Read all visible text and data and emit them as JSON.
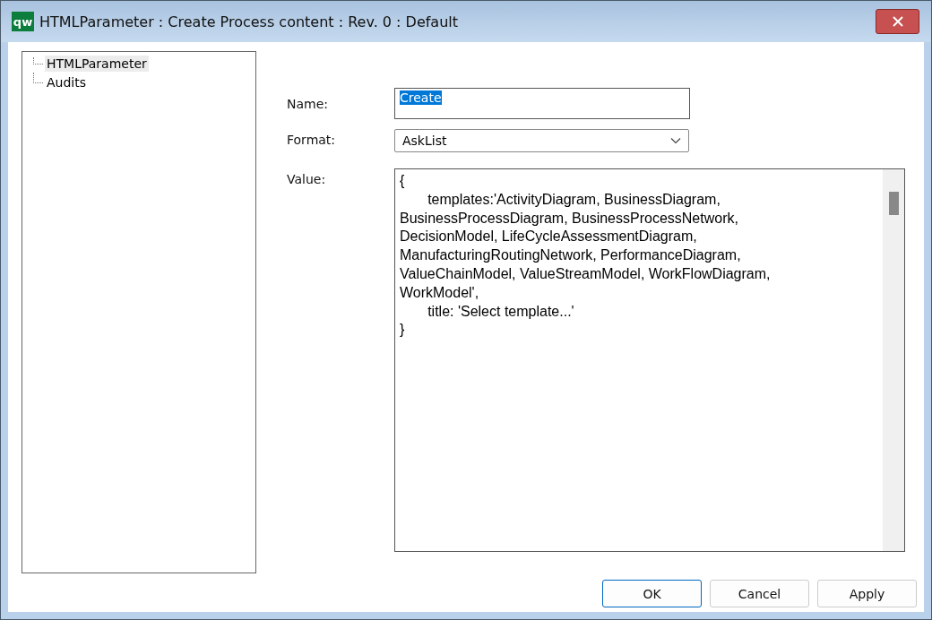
{
  "window": {
    "title": "HTMLParameter : Create Process content : Rev. 0  : Default",
    "logo": "qw"
  },
  "tree": {
    "items": [
      {
        "label": "HTMLParameter",
        "selected": true
      },
      {
        "label": "Audits",
        "selected": false
      }
    ]
  },
  "form": {
    "name_label": "Name:",
    "name_value": "Create",
    "name_value_selected": true,
    "format_label": "Format:",
    "format_value": "AskList",
    "value_label": "Value:",
    "value_lines": [
      "{",
      "\ttemplates:'ActivityDiagram, BusinessDiagram,",
      "BusinessProcessDiagram, BusinessProcessNetwork,",
      "DecisionModel, LifeCycleAssessmentDiagram,",
      "ManufacturingRoutingNetwork, PerformanceDiagram,",
      "ValueChainModel, ValueStreamModel, WorkFlowDiagram,",
      "WorkModel',",
      "\ttitle: 'Select template...'",
      "}"
    ]
  },
  "buttons": [
    {
      "label": "OK",
      "default": true
    },
    {
      "label": "Cancel",
      "default": false
    },
    {
      "label": "Apply",
      "default": false
    }
  ]
}
